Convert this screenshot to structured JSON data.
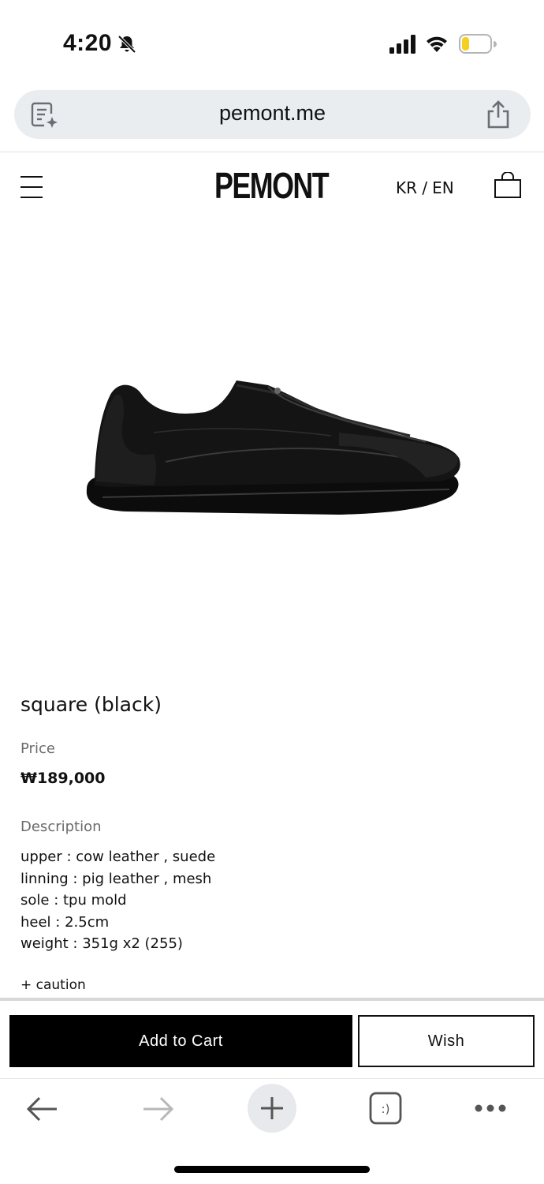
{
  "status_bar": {
    "time": "4:20",
    "battery_color": "#f5d020"
  },
  "browser": {
    "url": "pemont.me"
  },
  "site": {
    "logo": "PEMONT",
    "lang_kr": "KR /",
    "lang_en": "EN"
  },
  "product": {
    "title": "square (black)",
    "price_label": "Price",
    "price": "₩189,000",
    "description_label": "Description",
    "description_lines": [
      "upper : cow leather , suede",
      "linning : pig leather , mesh",
      "sole : tpu mold",
      "heel : 2.5cm",
      "weight : 351g x2 (255)"
    ],
    "caution": "+ caution"
  },
  "actions": {
    "add_to_cart": "Add to Cart",
    "wish": "Wish"
  },
  "toolbar": {
    "tabs_glyph": ":)"
  },
  "colors": {
    "image_bg": "#ebebeb",
    "url_bar_bg": "#eaedf0",
    "cart_button_bg": "#000000"
  }
}
